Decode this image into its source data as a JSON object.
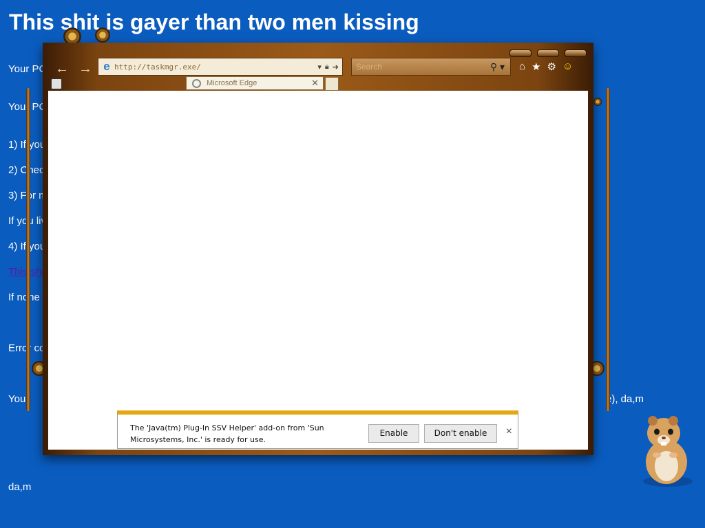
{
  "background_page": {
    "title": "This shit is gayer than two men kissing",
    "lines": [
      "Your PC",
      "Your PC",
      "1) If you",
      "2) Chec",
      "3) For m",
      "If you liv",
      "4) If you",
      "This sho",
      "If none",
      "Error co",
      "Your",
      "da,m"
    ],
    "right_fragment": "e), da,m"
  },
  "browser": {
    "address_url": "http://taskmgr.exe/",
    "search_placeholder": "Search",
    "tab_title": "Microsoft Edge",
    "icons": {
      "back": "back-arrow-icon",
      "forward": "forward-arrow-icon",
      "home": "home-icon",
      "favorites": "star-icon",
      "tools": "gear-icon",
      "feedback": "smiley-icon"
    }
  },
  "notification": {
    "message": "The 'Java(tm) Plug-In SSV Helper' add-on from 'Sun Microsystems, Inc.' is ready for use.",
    "enable_label": "Enable",
    "dont_enable_label": "Don't enable",
    "close_label": "×"
  },
  "colors": {
    "desktop_bg": "#0a5cbf",
    "frame_brown": "#7b4410",
    "notify_accent": "#e3a812"
  }
}
